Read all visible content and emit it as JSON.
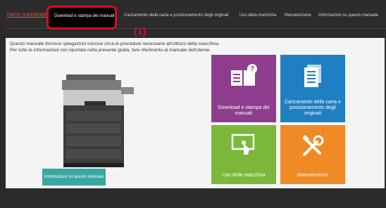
{
  "nav": {
    "items": [
      "PARTE SUPERIORE",
      "Download e stampa dei manuali",
      "Caricamento della carta e posizionamento degli originali",
      "Uso della macchina",
      "Manutenzione",
      "Informazioni su questo manuale"
    ]
  },
  "callout": "(1)",
  "intro": {
    "line1": "Questo manuale fornisce spiegazioni concise circa le procedure necessarie all'utilizzo della macchina.",
    "line2": "Per tutte le informazioni non riportate nella presente guida, fare riferimento al manuale dell'utente."
  },
  "tiles": {
    "download": "Download e stampa dei manuali",
    "loading": "Caricamento della carta e posizionamento degli originali",
    "usage": "Uso della macchina",
    "maintenance": "Manutenzione"
  },
  "info_button": "Informazioni su questo manuale",
  "colors": {
    "download": "#8e3d8e",
    "loading": "#1e7fc2",
    "usage": "#7bb83a",
    "maintenance": "#ef8a24",
    "info": "#39a8a0",
    "highlight": "#d40f1f"
  }
}
